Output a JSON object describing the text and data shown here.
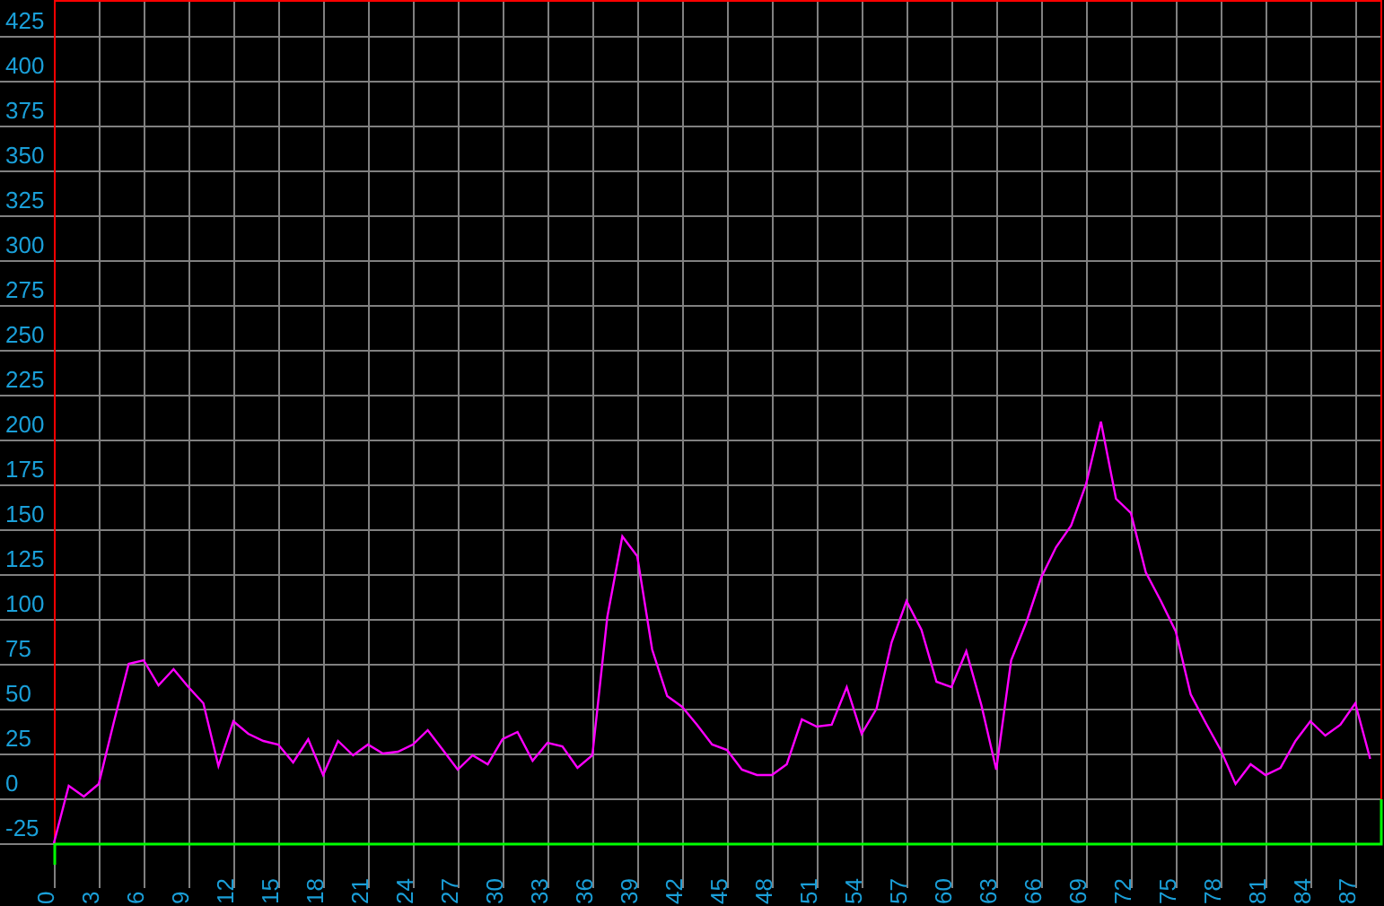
{
  "chart_data": {
    "type": "line",
    "x": [
      0,
      1,
      2,
      3,
      4,
      5,
      6,
      7,
      8,
      9,
      10,
      11,
      12,
      13,
      14,
      15,
      16,
      17,
      18,
      19,
      20,
      21,
      22,
      23,
      24,
      25,
      26,
      27,
      28,
      29,
      30,
      31,
      32,
      33,
      34,
      35,
      36,
      37,
      38,
      39,
      40,
      41,
      42,
      43,
      44,
      45,
      46,
      47,
      48,
      49,
      50,
      51,
      52,
      53,
      54,
      55,
      56,
      57,
      58,
      59,
      60,
      61,
      62,
      63,
      64,
      65,
      66,
      67,
      68,
      69,
      70,
      71,
      72,
      73,
      74,
      75,
      76,
      77,
      78,
      79,
      80,
      81,
      82,
      83,
      84,
      85,
      86,
      87,
      88
    ],
    "series": [
      {
        "color": "#ff00ff",
        "values": [
          -25,
          7,
          1,
          8,
          42,
          75,
          77,
          63,
          72,
          62,
          53,
          18,
          43,
          36,
          32,
          30,
          20,
          33,
          13,
          32,
          24,
          30,
          25,
          26,
          30,
          38,
          27,
          16,
          24,
          19,
          33,
          37,
          21,
          31,
          29,
          17,
          24,
          101,
          146,
          135,
          83,
          57,
          51,
          41,
          30,
          27,
          16,
          13,
          13,
          19,
          44,
          40,
          41,
          62,
          36,
          50,
          87,
          110,
          94,
          65,
          62,
          82,
          52,
          16,
          77,
          98,
          123,
          140,
          152,
          175,
          210,
          167,
          159,
          126,
          110,
          93,
          58,
          42,
          27,
          8,
          19,
          13,
          17,
          32,
          43,
          35,
          41,
          53,
          22
        ]
      }
    ],
    "xlim": [
      0,
      88.8
    ],
    "ylim": [
      -25,
      445
    ],
    "grid": true,
    "xticks": [
      0,
      3,
      6,
      9,
      12,
      15,
      18,
      21,
      24,
      27,
      30,
      33,
      36,
      39,
      42,
      45,
      48,
      51,
      54,
      57,
      60,
      63,
      66,
      69,
      72,
      75,
      78,
      81,
      84,
      87
    ],
    "yticks": [
      -25,
      0,
      25,
      50,
      75,
      100,
      125,
      150,
      175,
      200,
      225,
      250,
      275,
      300,
      325,
      350,
      375,
      400,
      425
    ]
  }
}
